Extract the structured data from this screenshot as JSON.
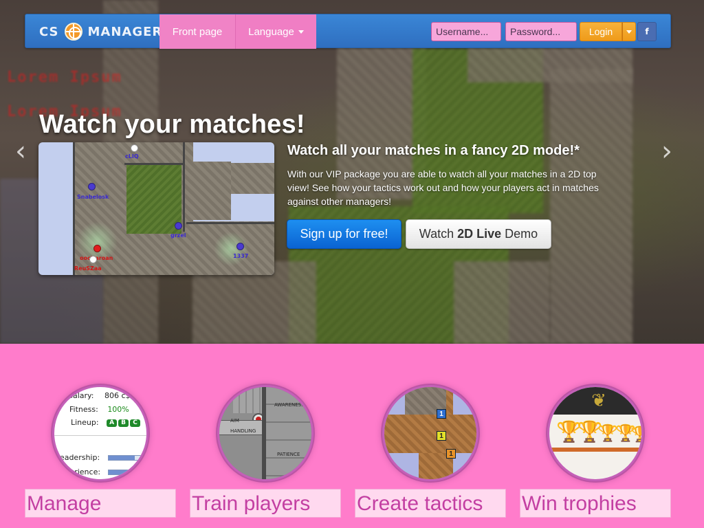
{
  "navbar": {
    "brand_left": "CS",
    "brand_right": "MANAGER",
    "nav_front": "Front page",
    "nav_language": "Language",
    "username_placeholder": "Username...",
    "password_placeholder": "Password...",
    "login_label": "Login",
    "facebook_label": "f"
  },
  "hero": {
    "title": "Watch your matches!",
    "subtitle": "Watch all your matches in a fancy 2D mode!*",
    "text": "With our VIP package you are able to watch all your matches in a 2D top view! See how your tactics work out and how your players act in matches against other managers!",
    "signup_label": "Sign up for free!",
    "demo_pre": "Watch",
    "demo_bold": "2D Live",
    "demo_post": "Demo",
    "arrow_left": "‹",
    "arrow_right": "›"
  },
  "preview": {
    "players": {
      "p1": "cLIQ",
      "p2": "Snabelosk",
      "p3": "grzel",
      "p4": "1337",
      "p5": "oocHaroan",
      "p6": "ReuSZaa"
    }
  },
  "features": [
    {
      "label": "Manage"
    },
    {
      "label": "Train players"
    },
    {
      "label": "Create tactics"
    },
    {
      "label": "Win trophies"
    }
  ],
  "manage_card": {
    "salary_label": "Salary:",
    "salary_value": "806 c$",
    "fitness_label": "Fitness:",
    "fitness_value": "100%",
    "lineup_label": "Lineup:",
    "lineup": [
      "A",
      "B",
      "C"
    ],
    "leadership_label": "Leadership:",
    "experience_label": "Experience:"
  },
  "train_card": {
    "labels": [
      "AWARENESS",
      "AIM",
      "HANDLING",
      "PATIENCE"
    ]
  },
  "tactics_card": {
    "markers": [
      "1",
      "1",
      "1"
    ]
  },
  "colors": {
    "accent_pink": "#ff7ccb",
    "nav_blue": "#2f6fc0",
    "login_orange": "#ef9b1a",
    "signup_blue": "#0a63d2"
  }
}
